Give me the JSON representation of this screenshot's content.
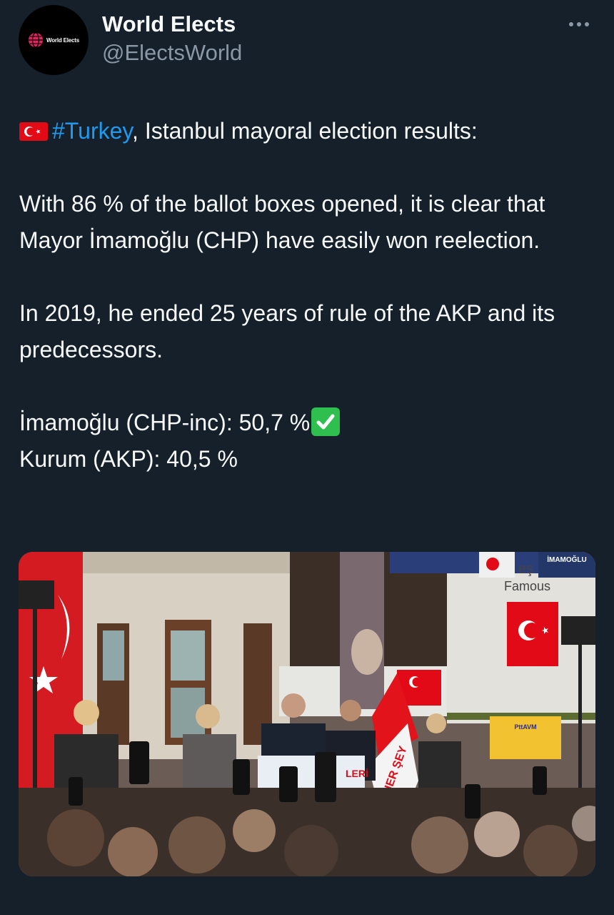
{
  "author": {
    "display_name": "World Elects",
    "handle": "@ElectsWorld",
    "avatar_text": "World Elects"
  },
  "tweet": {
    "hashtag": "#Turkey",
    "line1_rest": ", Istanbul mayoral election results:",
    "para2": "With 86 % of the ballot boxes opened, it is clear that Mayor İmamoğlu (CHP) have easily won reelection.",
    "para3": "In 2019, he ended 25 years of rule of the AKP and its predecessors.",
    "result1": "İmamoğlu (CHP-inc): 50,7 %",
    "result2": "Kurum (AKP): 40,5 %"
  },
  "photo": {
    "sign_top": "İMAMOĞLU",
    "sign_shop": "eş",
    "sign_shop2": "Famous",
    "podium_text": "LERİ",
    "kiosk_text": "PttAVM",
    "flag_text": "HER ŞEY"
  },
  "colors": {
    "background": "#15202b",
    "text": "#f7f9f9",
    "secondary": "#8b98a5",
    "link": "#1d9bf0",
    "flag_red": "#e30a17",
    "check_green": "#2fbf4f"
  },
  "icons": {
    "more": "more-dots-icon",
    "flag": "turkey-flag-icon",
    "check": "check-mark-icon",
    "avatar": "globe-icon"
  }
}
